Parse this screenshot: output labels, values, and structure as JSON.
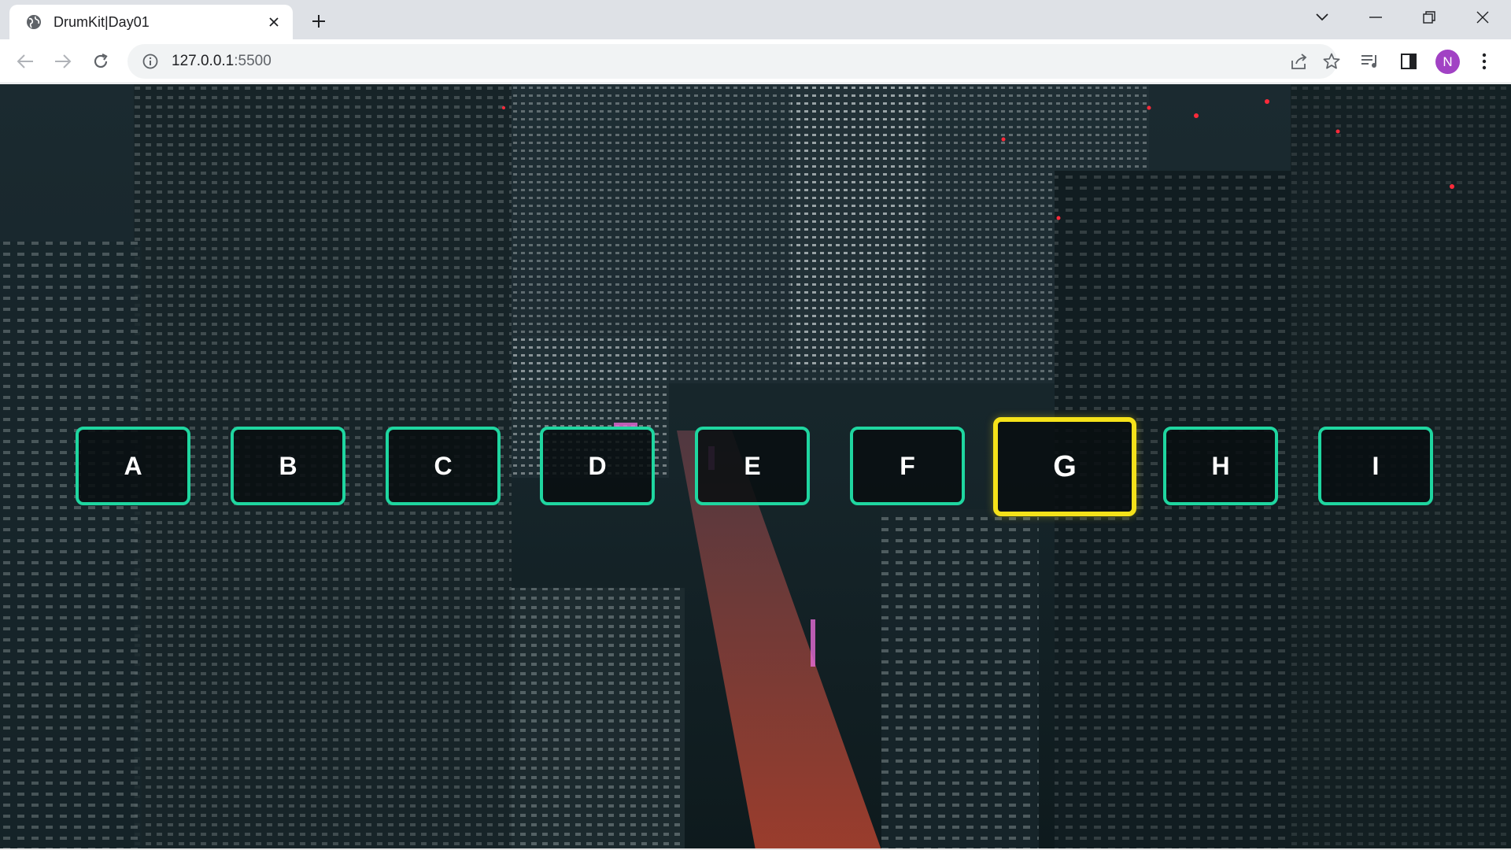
{
  "browser": {
    "tab": {
      "title": "DrumKit|Day01",
      "favicon": "globe-icon"
    },
    "address": {
      "host": "127.0.0.1",
      "port": ":5500"
    },
    "profile_initial": "N",
    "colors": {
      "tabstrip": "#dee1e6",
      "avatar": "#a142c4"
    }
  },
  "page": {
    "background": "night-city-aerial-photo",
    "keys": [
      {
        "letter": "A",
        "playing": false
      },
      {
        "letter": "B",
        "playing": false
      },
      {
        "letter": "C",
        "playing": false
      },
      {
        "letter": "D",
        "playing": false
      },
      {
        "letter": "E",
        "playing": false
      },
      {
        "letter": "F",
        "playing": false
      },
      {
        "letter": "G",
        "playing": true
      },
      {
        "letter": "H",
        "playing": false
      },
      {
        "letter": "I",
        "playing": false
      }
    ],
    "colors": {
      "key_border": "#1fd6a0",
      "key_playing_border": "#f5e21a",
      "key_text": "#ffffff"
    }
  }
}
